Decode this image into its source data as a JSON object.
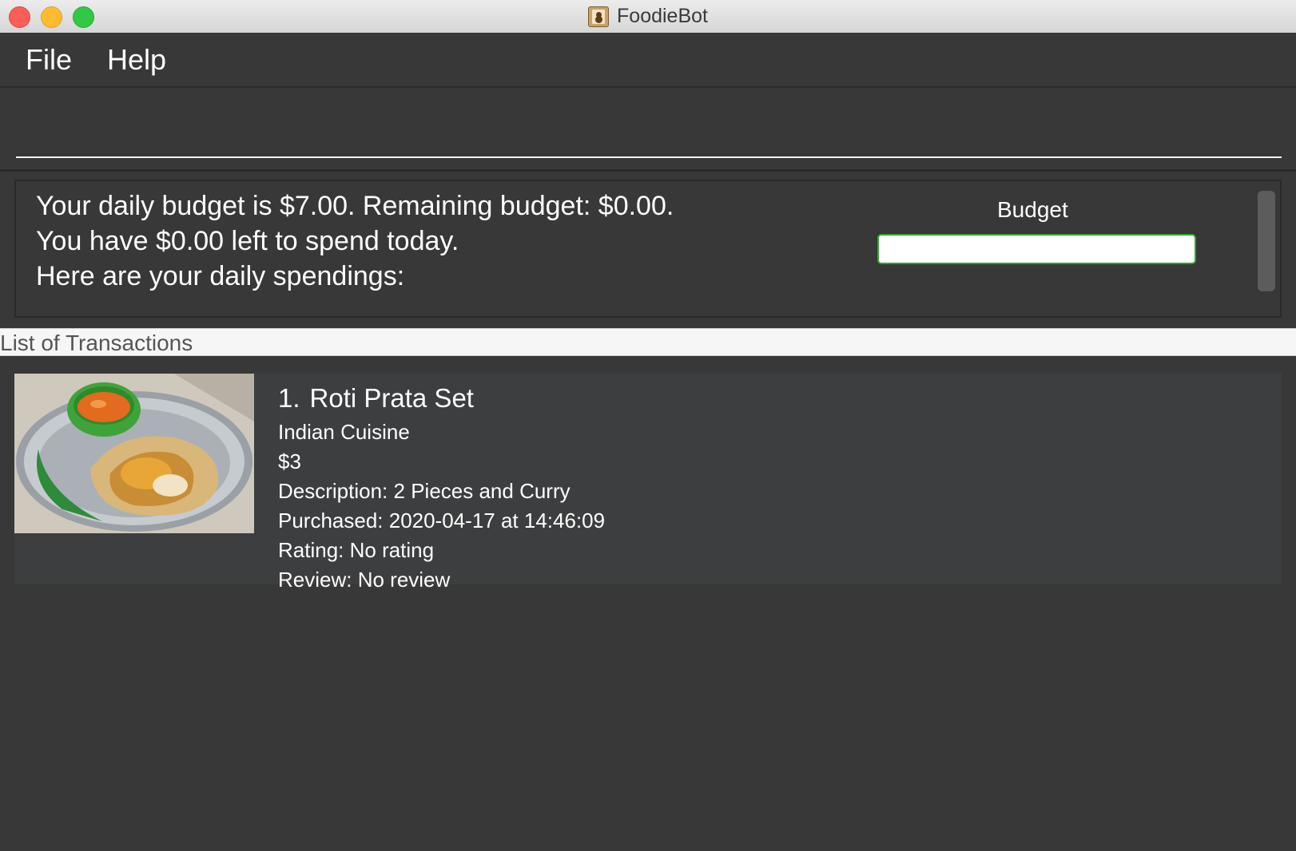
{
  "window": {
    "title": "FoodieBot"
  },
  "menu": {
    "file": "File",
    "help": "Help"
  },
  "command": {
    "value": ""
  },
  "result": {
    "lines": [
      "Your daily budget is $7.00. Remaining budget: $0.00.",
      "You have $0.00 left to spend today.",
      "Here are your daily spendings:"
    ],
    "budget_label": "Budget",
    "budget_progress_fraction": 0.0,
    "progress_color": "#2fa52f"
  },
  "list": {
    "header": "List of Transactions",
    "items": [
      {
        "index": "1.",
        "name": "Roti Prata Set",
        "cuisine": "Indian Cuisine",
        "price": "$3",
        "description_label": "Description:",
        "description": "2 Pieces and Curry",
        "purchased": "Purchased: 2020-04-17 at 14:46:09",
        "rating": "Rating: No rating",
        "review": "Review: No review",
        "photo_icon": "food-photo-roti-prata"
      }
    ]
  },
  "colors": {
    "background": "#383838",
    "card": "#3c3e3f",
    "list_header_bg": "#f6f6f6"
  }
}
